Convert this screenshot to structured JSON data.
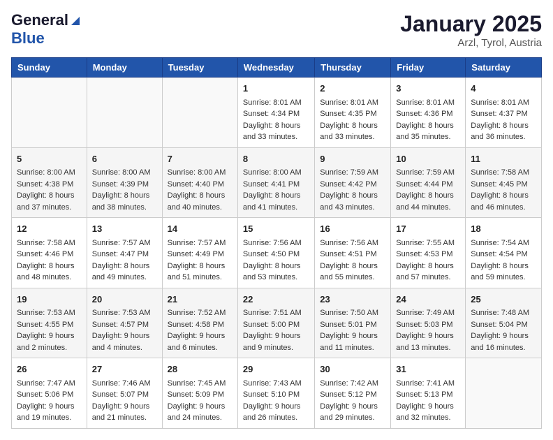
{
  "header": {
    "logo_general": "General",
    "logo_blue": "Blue",
    "month": "January 2025",
    "location": "Arzl, Tyrol, Austria"
  },
  "weekdays": [
    "Sunday",
    "Monday",
    "Tuesday",
    "Wednesday",
    "Thursday",
    "Friday",
    "Saturday"
  ],
  "weeks": [
    [
      {
        "day": "",
        "sunrise": "",
        "sunset": "",
        "daylight": ""
      },
      {
        "day": "",
        "sunrise": "",
        "sunset": "",
        "daylight": ""
      },
      {
        "day": "",
        "sunrise": "",
        "sunset": "",
        "daylight": ""
      },
      {
        "day": "1",
        "sunrise": "Sunrise: 8:01 AM",
        "sunset": "Sunset: 4:34 PM",
        "daylight": "Daylight: 8 hours and 33 minutes."
      },
      {
        "day": "2",
        "sunrise": "Sunrise: 8:01 AM",
        "sunset": "Sunset: 4:35 PM",
        "daylight": "Daylight: 8 hours and 33 minutes."
      },
      {
        "day": "3",
        "sunrise": "Sunrise: 8:01 AM",
        "sunset": "Sunset: 4:36 PM",
        "daylight": "Daylight: 8 hours and 35 minutes."
      },
      {
        "day": "4",
        "sunrise": "Sunrise: 8:01 AM",
        "sunset": "Sunset: 4:37 PM",
        "daylight": "Daylight: 8 hours and 36 minutes."
      }
    ],
    [
      {
        "day": "5",
        "sunrise": "Sunrise: 8:00 AM",
        "sunset": "Sunset: 4:38 PM",
        "daylight": "Daylight: 8 hours and 37 minutes."
      },
      {
        "day": "6",
        "sunrise": "Sunrise: 8:00 AM",
        "sunset": "Sunset: 4:39 PM",
        "daylight": "Daylight: 8 hours and 38 minutes."
      },
      {
        "day": "7",
        "sunrise": "Sunrise: 8:00 AM",
        "sunset": "Sunset: 4:40 PM",
        "daylight": "Daylight: 8 hours and 40 minutes."
      },
      {
        "day": "8",
        "sunrise": "Sunrise: 8:00 AM",
        "sunset": "Sunset: 4:41 PM",
        "daylight": "Daylight: 8 hours and 41 minutes."
      },
      {
        "day": "9",
        "sunrise": "Sunrise: 7:59 AM",
        "sunset": "Sunset: 4:42 PM",
        "daylight": "Daylight: 8 hours and 43 minutes."
      },
      {
        "day": "10",
        "sunrise": "Sunrise: 7:59 AM",
        "sunset": "Sunset: 4:44 PM",
        "daylight": "Daylight: 8 hours and 44 minutes."
      },
      {
        "day": "11",
        "sunrise": "Sunrise: 7:58 AM",
        "sunset": "Sunset: 4:45 PM",
        "daylight": "Daylight: 8 hours and 46 minutes."
      }
    ],
    [
      {
        "day": "12",
        "sunrise": "Sunrise: 7:58 AM",
        "sunset": "Sunset: 4:46 PM",
        "daylight": "Daylight: 8 hours and 48 minutes."
      },
      {
        "day": "13",
        "sunrise": "Sunrise: 7:57 AM",
        "sunset": "Sunset: 4:47 PM",
        "daylight": "Daylight: 8 hours and 49 minutes."
      },
      {
        "day": "14",
        "sunrise": "Sunrise: 7:57 AM",
        "sunset": "Sunset: 4:49 PM",
        "daylight": "Daylight: 8 hours and 51 minutes."
      },
      {
        "day": "15",
        "sunrise": "Sunrise: 7:56 AM",
        "sunset": "Sunset: 4:50 PM",
        "daylight": "Daylight: 8 hours and 53 minutes."
      },
      {
        "day": "16",
        "sunrise": "Sunrise: 7:56 AM",
        "sunset": "Sunset: 4:51 PM",
        "daylight": "Daylight: 8 hours and 55 minutes."
      },
      {
        "day": "17",
        "sunrise": "Sunrise: 7:55 AM",
        "sunset": "Sunset: 4:53 PM",
        "daylight": "Daylight: 8 hours and 57 minutes."
      },
      {
        "day": "18",
        "sunrise": "Sunrise: 7:54 AM",
        "sunset": "Sunset: 4:54 PM",
        "daylight": "Daylight: 8 hours and 59 minutes."
      }
    ],
    [
      {
        "day": "19",
        "sunrise": "Sunrise: 7:53 AM",
        "sunset": "Sunset: 4:55 PM",
        "daylight": "Daylight: 9 hours and 2 minutes."
      },
      {
        "day": "20",
        "sunrise": "Sunrise: 7:53 AM",
        "sunset": "Sunset: 4:57 PM",
        "daylight": "Daylight: 9 hours and 4 minutes."
      },
      {
        "day": "21",
        "sunrise": "Sunrise: 7:52 AM",
        "sunset": "Sunset: 4:58 PM",
        "daylight": "Daylight: 9 hours and 6 minutes."
      },
      {
        "day": "22",
        "sunrise": "Sunrise: 7:51 AM",
        "sunset": "Sunset: 5:00 PM",
        "daylight": "Daylight: 9 hours and 9 minutes."
      },
      {
        "day": "23",
        "sunrise": "Sunrise: 7:50 AM",
        "sunset": "Sunset: 5:01 PM",
        "daylight": "Daylight: 9 hours and 11 minutes."
      },
      {
        "day": "24",
        "sunrise": "Sunrise: 7:49 AM",
        "sunset": "Sunset: 5:03 PM",
        "daylight": "Daylight: 9 hours and 13 minutes."
      },
      {
        "day": "25",
        "sunrise": "Sunrise: 7:48 AM",
        "sunset": "Sunset: 5:04 PM",
        "daylight": "Daylight: 9 hours and 16 minutes."
      }
    ],
    [
      {
        "day": "26",
        "sunrise": "Sunrise: 7:47 AM",
        "sunset": "Sunset: 5:06 PM",
        "daylight": "Daylight: 9 hours and 19 minutes."
      },
      {
        "day": "27",
        "sunrise": "Sunrise: 7:46 AM",
        "sunset": "Sunset: 5:07 PM",
        "daylight": "Daylight: 9 hours and 21 minutes."
      },
      {
        "day": "28",
        "sunrise": "Sunrise: 7:45 AM",
        "sunset": "Sunset: 5:09 PM",
        "daylight": "Daylight: 9 hours and 24 minutes."
      },
      {
        "day": "29",
        "sunrise": "Sunrise: 7:43 AM",
        "sunset": "Sunset: 5:10 PM",
        "daylight": "Daylight: 9 hours and 26 minutes."
      },
      {
        "day": "30",
        "sunrise": "Sunrise: 7:42 AM",
        "sunset": "Sunset: 5:12 PM",
        "daylight": "Daylight: 9 hours and 29 minutes."
      },
      {
        "day": "31",
        "sunrise": "Sunrise: 7:41 AM",
        "sunset": "Sunset: 5:13 PM",
        "daylight": "Daylight: 9 hours and 32 minutes."
      },
      {
        "day": "",
        "sunrise": "",
        "sunset": "",
        "daylight": ""
      }
    ]
  ]
}
